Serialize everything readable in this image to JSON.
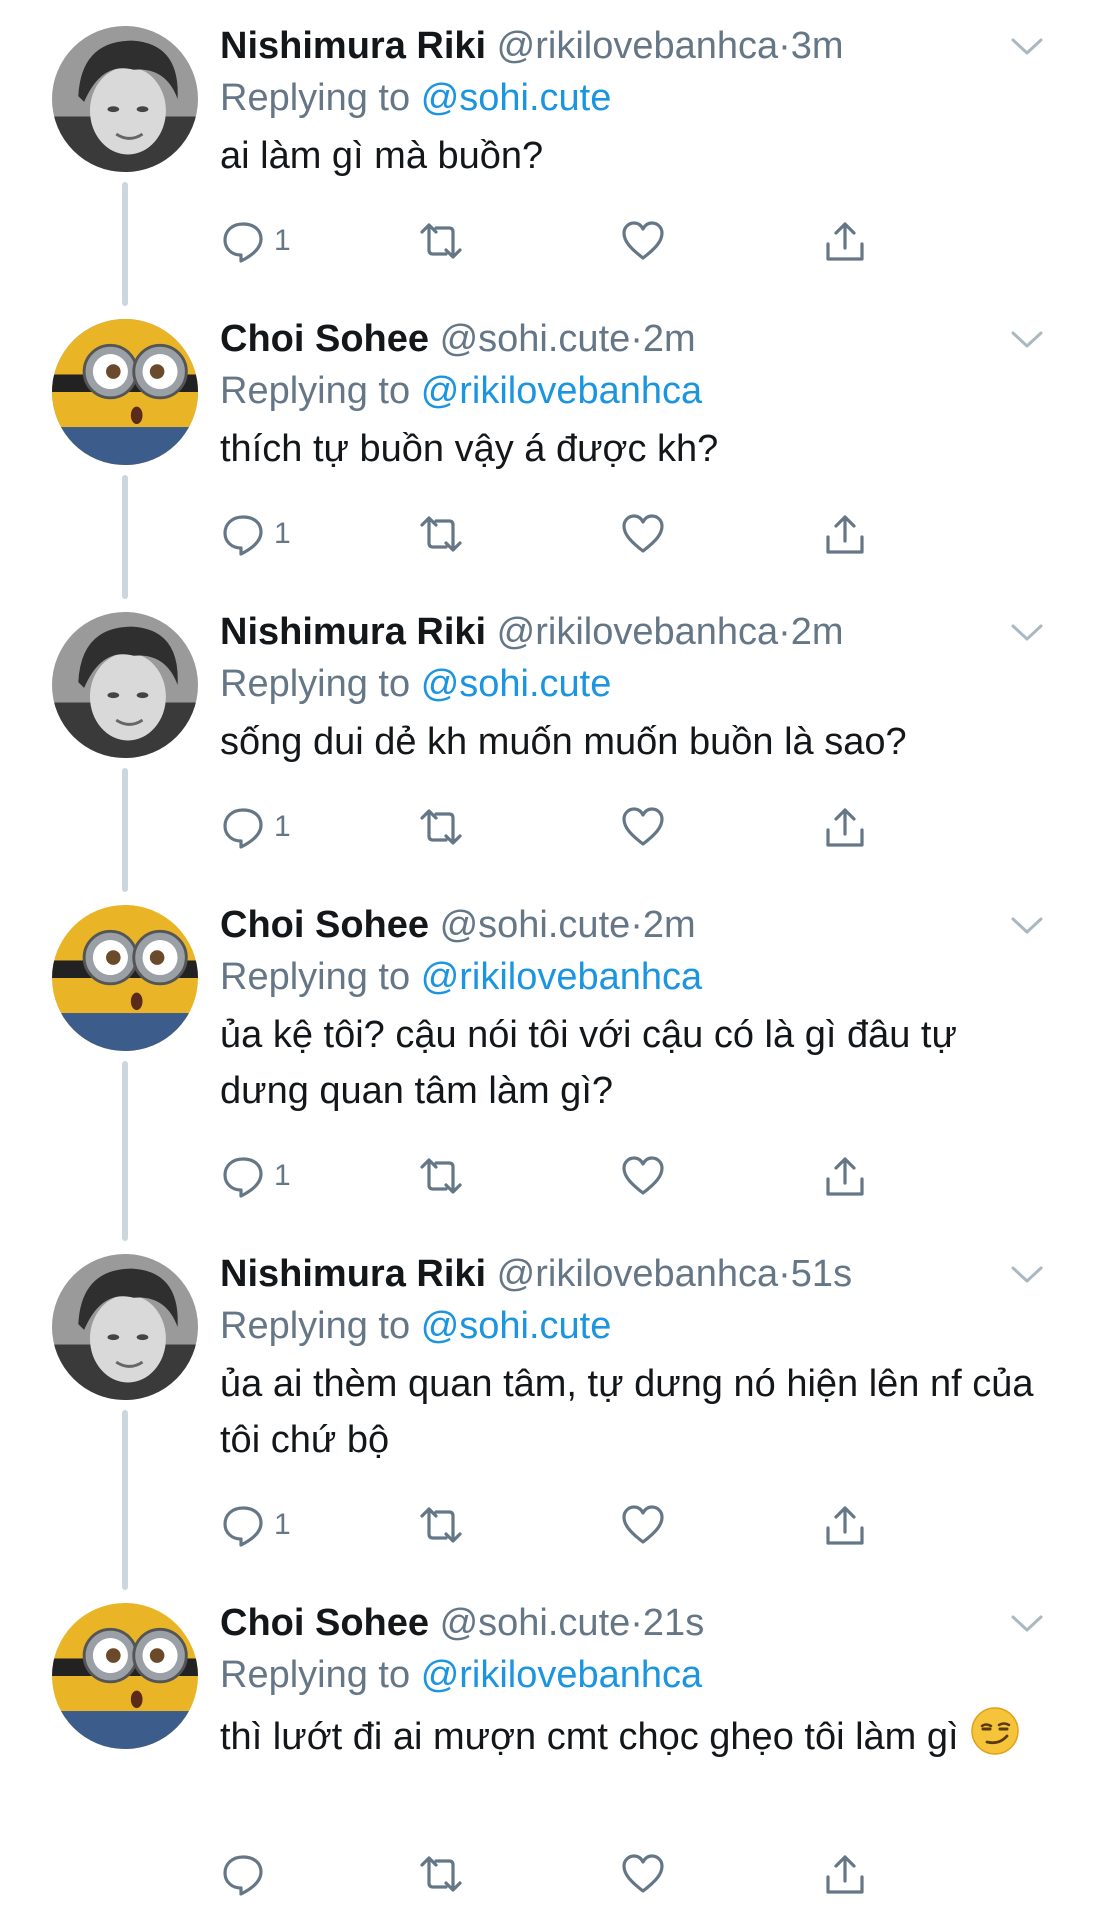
{
  "tweets": [
    {
      "name": "Nishimura Riki",
      "handle": "@rikilovebanhca",
      "time": "3m",
      "replying_prefix": "Replying to",
      "replying_to": "@sohi.cute",
      "text": "ai làm gì mà buồn?",
      "reply_count": "1",
      "avatar": "person-avatar"
    },
    {
      "name": "Choi Sohee",
      "handle": "@sohi.cute",
      "time": "2m",
      "replying_prefix": "Replying to",
      "replying_to": "@rikilovebanhca",
      "text": "thích tự buồn vậy á được kh?",
      "reply_count": "1",
      "avatar": "minion-avatar"
    },
    {
      "name": "Nishimura Riki",
      "handle": "@rikilovebanhca",
      "time": "2m",
      "replying_prefix": "Replying to",
      "replying_to": "@sohi.cute",
      "text": "sống dui dẻ kh muốn muốn buồn là sao?",
      "reply_count": "1",
      "avatar": "person-avatar"
    },
    {
      "name": "Choi Sohee",
      "handle": "@sohi.cute",
      "time": "2m",
      "replying_prefix": "Replying to",
      "replying_to": "@rikilovebanhca",
      "text": "ủa kệ tôi? cậu nói tôi với cậu có là gì đâu tự dưng quan tâm làm gì?",
      "reply_count": "1",
      "avatar": "minion-avatar"
    },
    {
      "name": "Nishimura Riki",
      "handle": "@rikilovebanhca",
      "time": "51s",
      "replying_prefix": "Replying to",
      "replying_to": "@sohi.cute",
      "text": "ủa ai thèm quan tâm, tự dưng nó hiện lên nf của tôi chứ bộ",
      "reply_count": "1",
      "avatar": "person-avatar"
    },
    {
      "name": "Choi Sohee",
      "handle": "@sohi.cute",
      "time": "21s",
      "replying_prefix": "Replying to",
      "replying_to": "@rikilovebanhca",
      "text": "thì lướt đi ai mượn cmt chọc ghẹo tôi làm gì",
      "text_emoji": "smirking-face-emoji",
      "reply_count": "",
      "avatar": "minion-avatar"
    }
  ],
  "meta_separator": "·",
  "colors": {
    "text": "#14171a",
    "secondary": "#657786",
    "link": "#1b95e0",
    "thread_line": "#ccd6dd"
  }
}
